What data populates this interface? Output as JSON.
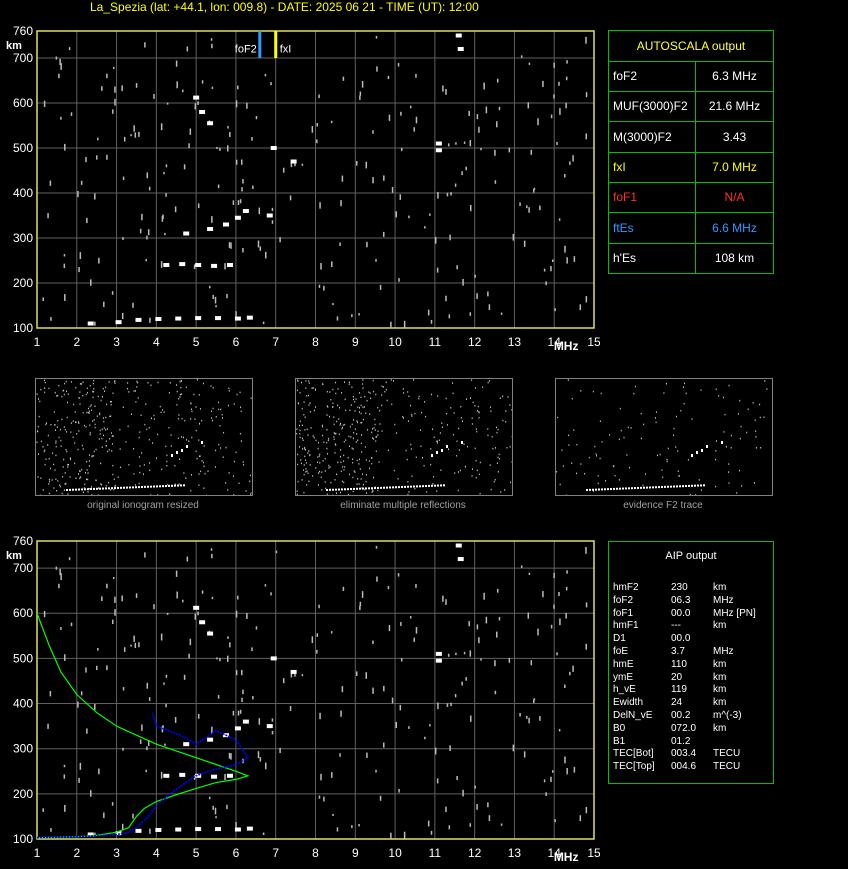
{
  "header": "La_Spezia (lat: +44.1, lon: 009.8) - DATE: 2025 06 21 - TIME (UT): 12:00",
  "chart_data": [
    {
      "type": "scatter",
      "name": "ionogram",
      "xlabel": "MHz",
      "ylabel": "km",
      "xlim": [
        1,
        15
      ],
      "ylim": [
        100,
        760
      ],
      "xticks": [
        "1",
        "2",
        "3",
        "4",
        "5",
        "6",
        "7",
        "8",
        "9",
        "10",
        "11",
        "12",
        "13",
        "14",
        "15"
      ],
      "yticks": [
        "100",
        "200",
        "300",
        "400",
        "500",
        "600",
        "700",
        "760"
      ],
      "markers": [
        {
          "label": "foF2",
          "x": 6.6,
          "color": "#3399ff"
        },
        {
          "label": "fxI",
          "x": 7.0,
          "color": "#ffff00"
        }
      ],
      "traces": {
        "E_layer": [
          [
            2.3,
            110
          ],
          [
            3.0,
            113
          ],
          [
            3.5,
            118
          ],
          [
            4.0,
            120
          ],
          [
            4.5,
            121
          ],
          [
            5.0,
            122
          ],
          [
            5.5,
            122
          ],
          [
            6.0,
            121
          ],
          [
            6.3,
            123
          ]
        ],
        "Es_second": [
          [
            4.2,
            240
          ],
          [
            4.6,
            242
          ],
          [
            5.0,
            240
          ],
          [
            5.4,
            238
          ],
          [
            5.8,
            240
          ]
        ],
        "F2_trace": [
          [
            4.7,
            310
          ],
          [
            5.3,
            320
          ],
          [
            5.7,
            330
          ],
          [
            6.0,
            345
          ],
          [
            6.2,
            360
          ],
          [
            6.8,
            350
          ]
        ],
        "F2_multiple": [
          [
            4.95,
            612
          ],
          [
            5.1,
            580
          ],
          [
            5.3,
            555
          ]
        ],
        "scattered": [
          [
            11.05,
            510
          ],
          [
            11.05,
            495
          ],
          [
            11.55,
            750
          ],
          [
            11.6,
            720
          ],
          [
            6.9,
            500
          ],
          [
            7.4,
            470
          ]
        ]
      }
    },
    {
      "type": "line",
      "name": "aip_profile",
      "xlabel": "MHz",
      "ylabel": "km",
      "xlim": [
        1,
        15
      ],
      "ylim": [
        100,
        760
      ],
      "xticks": [
        "1",
        "2",
        "3",
        "4",
        "5",
        "6",
        "7",
        "8",
        "9",
        "10",
        "11",
        "12",
        "13",
        "14",
        "15"
      ],
      "yticks": [
        "100",
        "200",
        "300",
        "400",
        "500",
        "600",
        "700",
        "760"
      ],
      "series": [
        {
          "color": "#00ff00",
          "x": [
            1.0,
            1.3,
            1.6,
            2.0,
            2.5,
            3.0,
            3.5,
            4.0,
            4.5,
            5.0,
            5.5,
            6.0,
            6.3,
            6.0,
            5.5,
            5.0,
            4.5,
            4.0,
            3.7,
            3.5,
            3.3,
            3.0,
            2.5,
            2.0,
            1.5,
            1.0
          ],
          "y": [
            600,
            530,
            470,
            420,
            380,
            350,
            330,
            310,
            295,
            280,
            265,
            250,
            240,
            232,
            225,
            212,
            198,
            183,
            168,
            150,
            125,
            115,
            108,
            105,
            104,
            103
          ]
        },
        {
          "color": "#0000ff",
          "x": [
            1.0,
            1.5,
            2.0,
            2.5,
            3.0,
            3.3,
            3.5,
            3.8,
            4.0,
            4.5,
            5.0,
            5.5,
            6.0,
            6.3,
            6.0,
            5.5,
            5.0,
            4.6,
            4.3,
            4.0,
            3.9
          ],
          "y": [
            103,
            104,
            105,
            107,
            110,
            115,
            125,
            150,
            175,
            210,
            240,
            255,
            265,
            280,
            320,
            340,
            310,
            330,
            340,
            350,
            380
          ]
        }
      ]
    }
  ],
  "thumbnails": [
    {
      "caption": "original ionogram resized"
    },
    {
      "caption": "eliminate multiple reflections"
    },
    {
      "caption": "evidence F2 trace"
    }
  ],
  "autoscala": {
    "title": "AUTOSCALA output",
    "rows": [
      {
        "label": "foF2",
        "value": "6.3 MHz",
        "color": "#ffffff"
      },
      {
        "label": "MUF(3000)F2",
        "value": "21.6 MHz",
        "color": "#ffffff"
      },
      {
        "label": "M(3000)F2",
        "value": "3.43",
        "color": "#ffffff"
      },
      {
        "label": "fxI",
        "value": "7.0 MHz",
        "color": "#ffff00"
      },
      {
        "label": "foF1",
        "value": "N/A",
        "color": "#ff3030"
      },
      {
        "label": "ftEs",
        "value": "6.6 MHz",
        "color": "#3399ff"
      },
      {
        "label": "h'Es",
        "value": "108     km",
        "color": "#ffffff"
      }
    ]
  },
  "aip": {
    "title": "AIP output",
    "rows": [
      {
        "name": "hmF2",
        "value": "230",
        "unit": "km"
      },
      {
        "name": "foF2",
        "value": "06.3",
        "unit": "MHz"
      },
      {
        "name": "foF1",
        "value": "00.0",
        "unit": "MHz   [PN]"
      },
      {
        "name": "hmF1",
        "value": "---",
        "unit": "km"
      },
      {
        "name": "D1",
        "value": "00.0",
        "unit": ""
      },
      {
        "name": "foE",
        "value": "3.7",
        "unit": "MHz"
      },
      {
        "name": "hmE",
        "value": "110",
        "unit": "km"
      },
      {
        "name": "ymE",
        "value": "20",
        "unit": "km"
      },
      {
        "name": "h_vE",
        "value": "119",
        "unit": "km"
      },
      {
        "name": "Ewidth",
        "value": "24",
        "unit": "km"
      },
      {
        "name": "DelN_vE",
        "value": "00.2",
        "unit": "m^(-3)"
      },
      {
        "name": "B0",
        "value": "072.0",
        "unit": "km"
      },
      {
        "name": "B1",
        "value": "01.2",
        "unit": ""
      },
      {
        "name": "TEC[Bot]",
        "value": "003.4",
        "unit": "TECU"
      },
      {
        "name": "TEC[Top]",
        "value": "004.6",
        "unit": "TECU"
      }
    ]
  }
}
